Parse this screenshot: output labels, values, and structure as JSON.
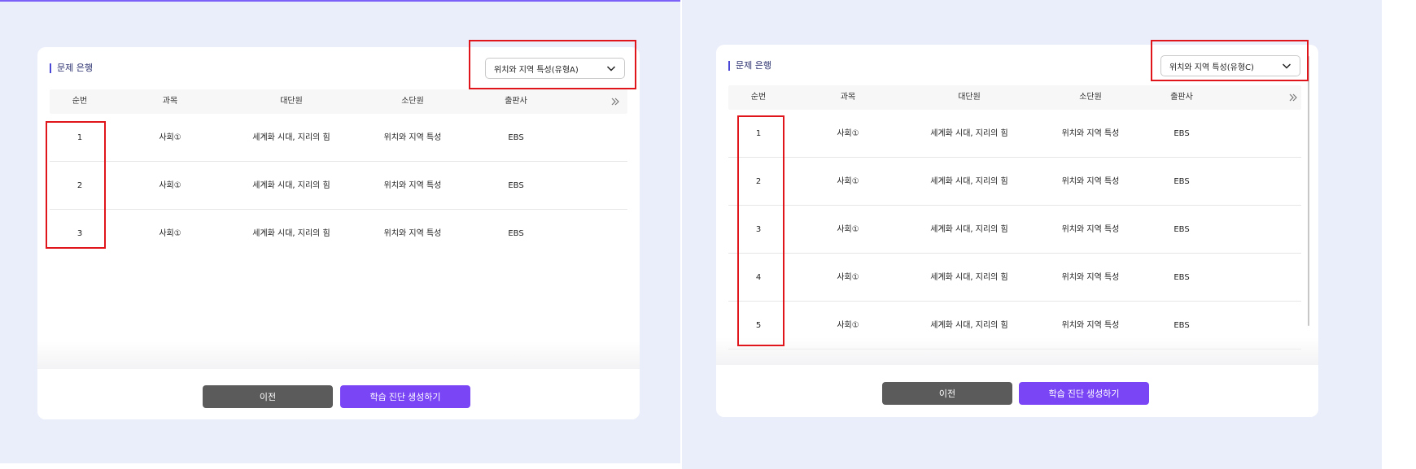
{
  "header_cols": [
    "순번",
    "과목",
    "대단원",
    "소단원",
    "출판사"
  ],
  "left": {
    "title": "문제 은행",
    "dropdown_value": "위치와 지역 특성(유형A)",
    "rows": [
      {
        "no": "1",
        "subject": "사회①",
        "major_unit": "세계화 시대, 지리의 힘",
        "minor_unit": "위치와 지역 특성",
        "publisher": "EBS"
      },
      {
        "no": "2",
        "subject": "사회①",
        "major_unit": "세계화 시대, 지리의 힘",
        "minor_unit": "위치와 지역 특성",
        "publisher": "EBS"
      },
      {
        "no": "3",
        "subject": "사회①",
        "major_unit": "세계화 시대, 지리의 힘",
        "minor_unit": "위치와 지역 특성",
        "publisher": "EBS"
      }
    ],
    "prev_label": "이전",
    "generate_label": "학습 진단 생성하기"
  },
  "right": {
    "title": "문제 은행",
    "dropdown_value": "위치와 지역 특성(유형C)",
    "rows": [
      {
        "no": "1",
        "subject": "사회①",
        "major_unit": "세계화 시대, 지리의 힘",
        "minor_unit": "위치와 지역 특성",
        "publisher": "EBS"
      },
      {
        "no": "2",
        "subject": "사회①",
        "major_unit": "세계화 시대, 지리의 힘",
        "minor_unit": "위치와 지역 특성",
        "publisher": "EBS"
      },
      {
        "no": "3",
        "subject": "사회①",
        "major_unit": "세계화 시대, 지리의 힘",
        "minor_unit": "위치와 지역 특성",
        "publisher": "EBS"
      },
      {
        "no": "4",
        "subject": "사회①",
        "major_unit": "세계화 시대, 지리의 힘",
        "minor_unit": "위치와 지역 특성",
        "publisher": "EBS"
      },
      {
        "no": "5",
        "subject": "사회①",
        "major_unit": "세계화 시대, 지리의 힘",
        "minor_unit": "위치와 지역 특성",
        "publisher": "EBS"
      }
    ],
    "prev_label": "이전",
    "generate_label": "학습 진단 생성하기"
  },
  "colors": {
    "accent": "#7a45f5",
    "secondary_button": "#5b5b5b",
    "background": "#eaeefb",
    "highlight_box": "#e0151c",
    "title_bar": "#4a46d6"
  }
}
